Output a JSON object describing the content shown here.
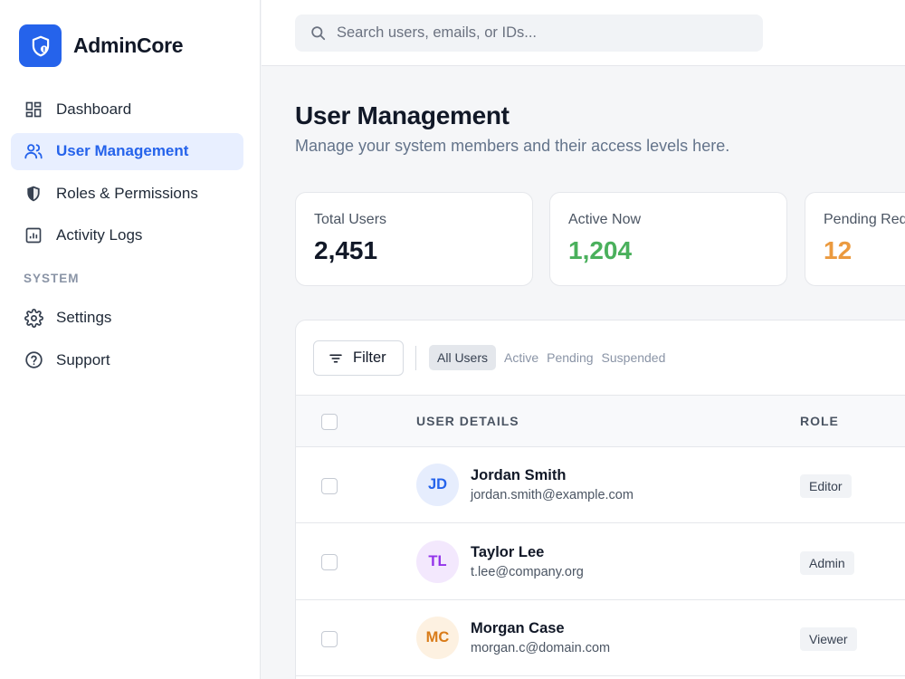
{
  "brand": {
    "name": "AdminCore"
  },
  "colors": {
    "accent": "#2563eb",
    "active_green": "#4ab05c",
    "pending_orange": "#eb9a3f"
  },
  "sidebar": {
    "items": [
      {
        "label": "Dashboard",
        "icon": "dashboard-icon"
      },
      {
        "label": "User Management",
        "icon": "users-icon",
        "active": true
      },
      {
        "label": "Roles & Permissions",
        "icon": "shield-icon"
      },
      {
        "label": "Activity Logs",
        "icon": "bar-chart-icon"
      }
    ],
    "section_label": "SYSTEM",
    "system_items": [
      {
        "label": "Settings",
        "icon": "gear-icon"
      },
      {
        "label": "Support",
        "icon": "help-circle-icon"
      }
    ]
  },
  "search": {
    "placeholder": "Search users, emails, or IDs..."
  },
  "page": {
    "title": "User Management",
    "subtitle": "Manage your system members and their access levels here."
  },
  "stats": [
    {
      "label": "Total Users",
      "value": "2,451"
    },
    {
      "label": "Active Now",
      "value": "1,204"
    },
    {
      "label": "Pending Requests",
      "value": "12"
    }
  ],
  "toolbar": {
    "filter_label": "Filter",
    "tabs": [
      "All Users",
      "Active",
      "Pending",
      "Suspended"
    ]
  },
  "table": {
    "headers": {
      "user": "USER DETAILS",
      "role": "ROLE"
    },
    "rows": [
      {
        "initials": "JD",
        "name": "Jordan Smith",
        "email": "jordan.smith@example.com",
        "role": "Editor"
      },
      {
        "initials": "TL",
        "name": "Taylor Lee",
        "email": "t.lee@company.org",
        "role": "Admin"
      },
      {
        "initials": "MC",
        "name": "Morgan Case",
        "email": "morgan.c@domain.com",
        "role": "Viewer"
      }
    ]
  }
}
